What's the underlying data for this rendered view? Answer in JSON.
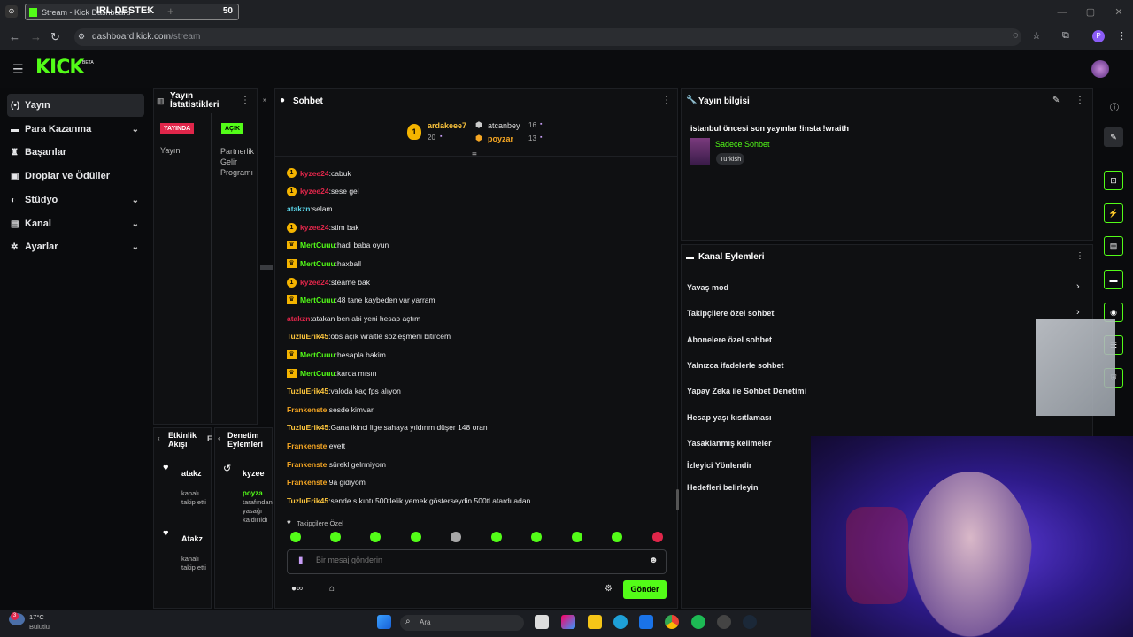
{
  "browser": {
    "tab_title": "Stream - Kick Dashboard",
    "overlay_label": "IRL DESTEK",
    "overlay_count": "50",
    "url_host": "dashboard.kick.com",
    "url_path": "/stream",
    "profile_initial": "P"
  },
  "kick": {
    "logo": "KICK",
    "beta": "BETA"
  },
  "sidebar": {
    "items": [
      {
        "label": "Yayın",
        "icon": "broadcast-icon"
      },
      {
        "label": "Para Kazanma",
        "icon": "money-icon"
      },
      {
        "label": "Başarılar",
        "icon": "trophy-icon"
      },
      {
        "label": "Droplar ve Ödüller",
        "icon": "gift-icon"
      },
      {
        "label": "Stüdyo",
        "icon": "studio-icon"
      },
      {
        "label": "Kanal",
        "icon": "channel-icon"
      },
      {
        "label": "Ayarlar",
        "icon": "gear-icon"
      }
    ]
  },
  "stats": {
    "title": "Yayın İstatistikleri",
    "live_badge": "YAYINDA",
    "open_badge": "AÇIK",
    "col1_label": "Yayın",
    "col2_label": "Partnerlik Gelir Programı"
  },
  "activity": {
    "title": "Etkinlik Akışı",
    "items": [
      {
        "name": "atakz",
        "text": "kanalı takip etti"
      },
      {
        "name": "Atakz",
        "text": "kanalı takip etti"
      }
    ]
  },
  "audit": {
    "title": "Denetim Eylemleri",
    "name": "kyzee",
    "actor": "poyza",
    "text": "tarafından yasağı kaldırıldı"
  },
  "chat": {
    "title": "Sohbet",
    "top": [
      {
        "name": "ardakeee7",
        "count": "20"
      },
      {
        "name": "atcanbey",
        "count": "16"
      },
      {
        "name": "poyzar",
        "count": "13"
      }
    ],
    "messages": [
      {
        "user": "kyzee24",
        "text": "cabuk",
        "color": "#e0264a",
        "badge": "1"
      },
      {
        "user": "kyzee24",
        "text": "sese gel",
        "color": "#e0264a",
        "badge": "1"
      },
      {
        "user": "atakzn",
        "text": "selam",
        "color": "#5ad2e6",
        "badge": ""
      },
      {
        "user": "kyzee24",
        "text": "stim bak",
        "color": "#e0264a",
        "badge": "1"
      },
      {
        "user": "MertCuuu",
        "text": "hadi baba oyun",
        "color": "#53fc18",
        "badge": "crown"
      },
      {
        "user": "MertCuuu",
        "text": "haxball",
        "color": "#53fc18",
        "badge": "crown"
      },
      {
        "user": "kyzee24",
        "text": "steame bak",
        "color": "#e0264a",
        "badge": "1"
      },
      {
        "user": "MertCuuu",
        "text": "48 tane kaybeden var yarram",
        "color": "#53fc18",
        "badge": "crown"
      },
      {
        "user": "atakzn",
        "text": "atakan ben abi yeni hesap açtım",
        "color": "#e0264a",
        "badge": ""
      },
      {
        "user": "TuzluErik45",
        "text": "obs açık wraitle sözleşmeni bitircem",
        "color": "#f9c23c",
        "badge": ""
      },
      {
        "user": "MertCuuu",
        "text": "hesapla bakim",
        "color": "#53fc18",
        "badge": "crown"
      },
      {
        "user": "MertCuuu",
        "text": "karda mısın",
        "color": "#53fc18",
        "badge": "crown"
      },
      {
        "user": "TuzluErik45",
        "text": "valoda kaç fps alıyon",
        "color": "#f9c23c",
        "badge": ""
      },
      {
        "user": "Frankenste",
        "text": "sesde kimvar",
        "color": "#f5a623",
        "badge": ""
      },
      {
        "user": "TuzluErik45",
        "text": "Gana ikinci lige sahaya yıldırım düşer 148 oran",
        "color": "#f9c23c",
        "badge": ""
      },
      {
        "user": "Frankenste",
        "text": "evett",
        "color": "#f5a623",
        "badge": ""
      },
      {
        "user": "Frankenste",
        "text": "sürekl gelrmiyom",
        "color": "#f5a623",
        "badge": ""
      },
      {
        "user": "Frankenste",
        "text": "9a gidiyom",
        "color": "#f5a623",
        "badge": ""
      },
      {
        "user": "TuzluErik45",
        "text": "sende sıkıntı 500tlelik yemek gösterseydin 500tl atardı adan",
        "color": "#f9c23c",
        "badge": ""
      }
    ],
    "followers_only": "Takipçilere Özel",
    "placeholder": "Bir mesaj gönderin",
    "send": "Gönder"
  },
  "stream_info": {
    "title": "Yayın bilgisi",
    "stream_title": "istanbul öncesi son yayınlar !insta !wraith",
    "category": "Sadece Sohbet",
    "language": "Turkish"
  },
  "channel_actions": {
    "title": "Kanal Eylemleri",
    "items": [
      "Yavaş mod",
      "Takipçilere özel sohbet",
      "Abonelere özel sohbet",
      "Yalnızca ifadelerle sohbet",
      "Yapay Zeka ile Sohbet Denetimi",
      "Hesap yaşı kısıtlaması",
      "Yasaklanmış kelimeler",
      "İzleyici Yönlendir",
      "Hedefleri belirleyin"
    ]
  },
  "taskbar": {
    "temp": "17°C",
    "weather": "Bulutlu",
    "search": "Ara",
    "notif": "3"
  },
  "colors": {
    "accent": "#53fc18",
    "bg": "#0a0b0d",
    "panel": "#0f1012"
  }
}
